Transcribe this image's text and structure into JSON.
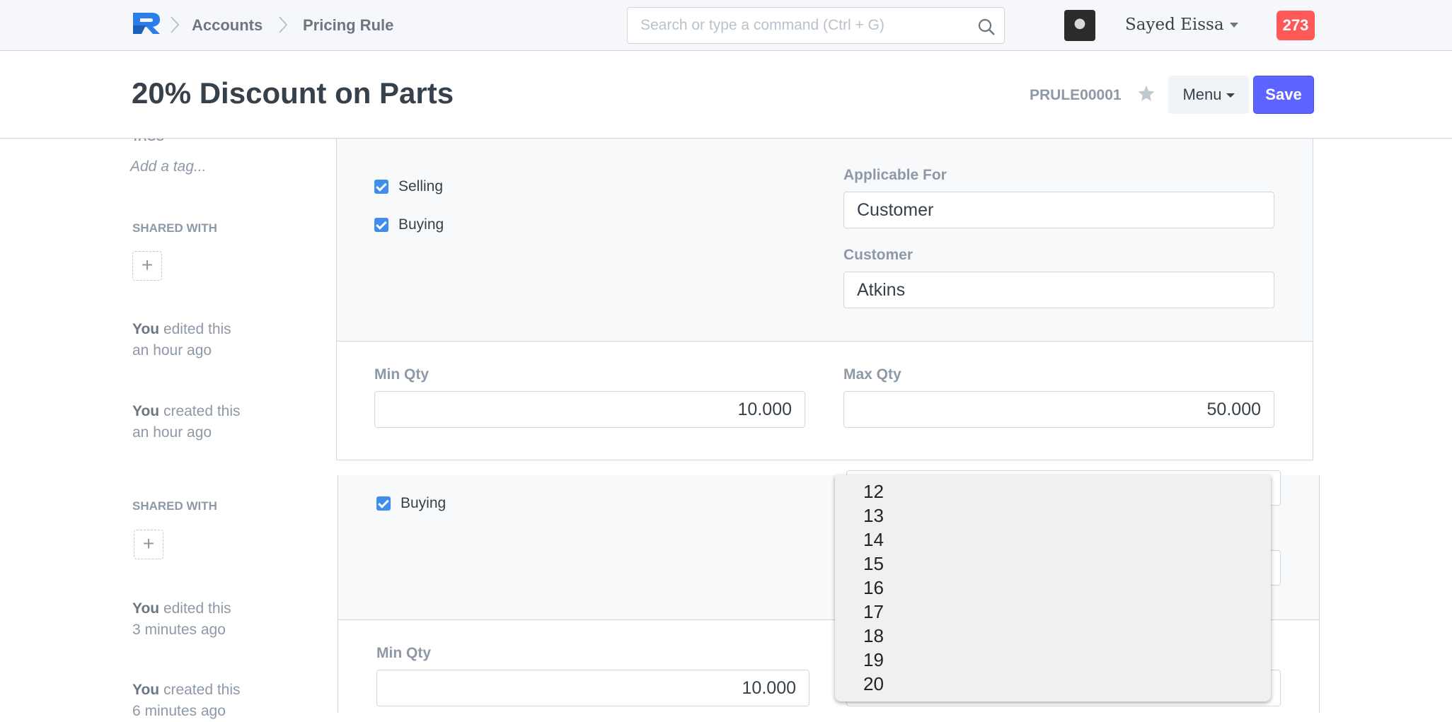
{
  "navbar": {
    "breadcrumbs": [
      "Accounts",
      "Pricing Rule"
    ],
    "search_placeholder": "Search or type a command (Ctrl + G)",
    "user_name": "Sayed Eissa",
    "notification_count": "273"
  },
  "page": {
    "title": "20% Discount on Parts",
    "doc_name": "PRULE00001",
    "menu_label": "Menu",
    "save_label": "Save"
  },
  "sidebar": {
    "tags_label": "TAGS",
    "add_tag": "Add a tag...",
    "shared_with_label": "SHARED WITH",
    "activity_top": [
      {
        "actor": "You",
        "action": "edited this",
        "time": "an hour ago"
      },
      {
        "actor": "You",
        "action": "created this",
        "time": "an hour ago"
      }
    ],
    "activity_bottom": [
      {
        "actor": "You",
        "action": "edited this",
        "time": "3 minutes ago"
      },
      {
        "actor": "You",
        "action": "created this",
        "time": "6 minutes ago"
      }
    ]
  },
  "form": {
    "selling_label": "Selling",
    "buying_label": "Buying",
    "applicable_for_label": "Applicable For",
    "applicable_for_value": "Customer",
    "customer_label": "Customer",
    "customer_value": "Atkins",
    "min_qty_label": "Min Qty",
    "min_qty_value": "10.000",
    "max_qty_label": "Max Qty",
    "max_qty_value": "50.000"
  },
  "dropdown_options": [
    "12",
    "13",
    "14",
    "15",
    "16",
    "17",
    "18",
    "19",
    "20"
  ],
  "colors": {
    "primary": "#5e64ff",
    "checkbox": "#3f8eed",
    "notification": "#ff5858"
  }
}
